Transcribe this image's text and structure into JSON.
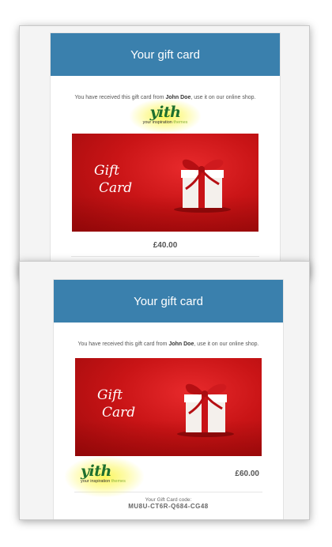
{
  "email1": {
    "header_title": "Your gift card",
    "intro_prefix": "You have received this gift card from",
    "sender": "John Doe",
    "intro_suffix": ", use it on our online shop.",
    "logo_wordmark": "yith",
    "logo_tagline_prefix": "your inspiration",
    "logo_tagline_suffix": "themes",
    "card_text_line1": "Gift",
    "card_text_line2": "Card",
    "price": "£40.00"
  },
  "email2": {
    "header_title": "Your gift card",
    "intro_prefix": "You have received this gift card from",
    "sender": "John Doe",
    "intro_suffix": ", use it on our online shop.",
    "card_text_line1": "Gift",
    "card_text_line2": "Card",
    "logo_wordmark": "yith",
    "logo_tagline_prefix": "your inspiration",
    "logo_tagline_suffix": "themes",
    "price": "£60.00",
    "code_label": "Your Gift Card code:",
    "code_value": "MU8U-CT6R-Q684-CG48"
  },
  "colors": {
    "header_bg": "#3a80ad",
    "logo_green": "#1e6f2f",
    "highlight_glow": "#faf550",
    "gift_red": "#c91416"
  }
}
